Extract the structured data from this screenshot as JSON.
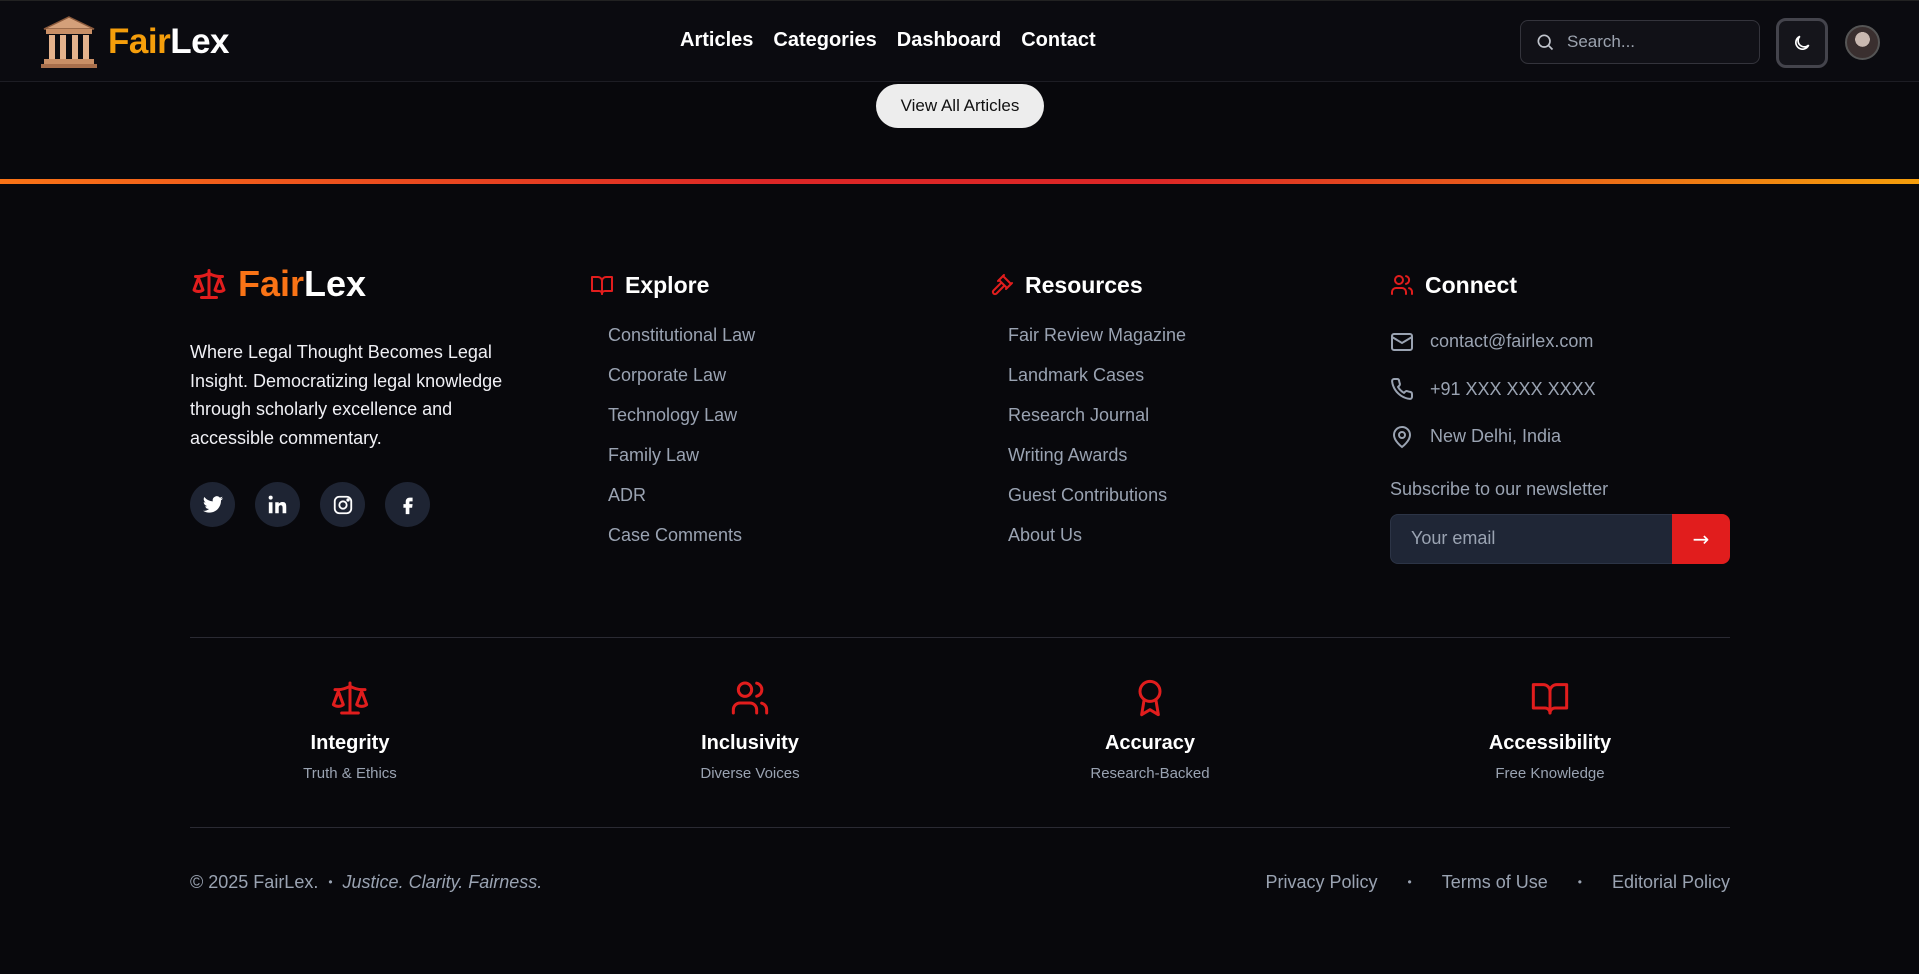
{
  "header": {
    "brand_fair": "Fair",
    "brand_lex": "Lex",
    "nav": [
      "Articles",
      "Categories",
      "Dashboard",
      "Contact"
    ],
    "search_placeholder": "Search...",
    "theme_icon": "moon-icon"
  },
  "view_all_label": "View All Articles",
  "footer": {
    "brand_fair": "Fair",
    "brand_lex": "Lex",
    "tagline": "Where Legal Thought Becomes Legal Insight. Democratizing legal knowledge through scholarly excellence and accessible commentary.",
    "socials": [
      "twitter-icon",
      "linkedin-icon",
      "instagram-icon",
      "facebook-icon"
    ],
    "explore": {
      "title": "Explore",
      "links": [
        "Constitutional Law",
        "Corporate Law",
        "Technology Law",
        "Family Law",
        "ADR",
        "Case Comments"
      ]
    },
    "resources": {
      "title": "Resources",
      "links": [
        "Fair Review Magazine",
        "Landmark Cases",
        "Research Journal",
        "Writing Awards",
        "Guest Contributions",
        "About Us"
      ]
    },
    "connect": {
      "title": "Connect",
      "email": "contact@fairlex.com",
      "phone": "+91 XXX XXX XXXX",
      "location": "New Delhi, India",
      "newsletter_label": "Subscribe to our newsletter",
      "email_placeholder": "Your email",
      "submit_label": "→"
    },
    "values": [
      {
        "title": "Integrity",
        "subtitle": "Truth & Ethics",
        "icon": "scale-icon"
      },
      {
        "title": "Inclusivity",
        "subtitle": "Diverse Voices",
        "icon": "users-icon"
      },
      {
        "title": "Accuracy",
        "subtitle": "Research-Backed",
        "icon": "award-icon"
      },
      {
        "title": "Accessibility",
        "subtitle": "Free Knowledge",
        "icon": "book-open-icon"
      }
    ],
    "copyright": "© 2025 FairLex.",
    "motto": "Justice. Clarity. Fairness.",
    "separator": "•",
    "policies": [
      "Privacy Policy",
      "Terms of Use",
      "Editorial Policy"
    ]
  },
  "colors": {
    "accent_red": "#e11d1d",
    "accent_orange": "#f97316",
    "brand_amber": "#f59e0b",
    "background": "#08080c"
  }
}
